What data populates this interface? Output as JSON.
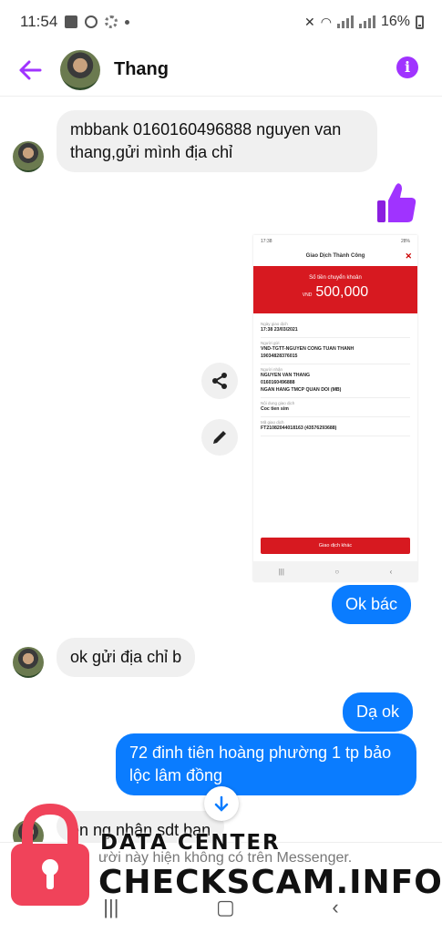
{
  "status_bar": {
    "time": "11:54",
    "battery": "16%"
  },
  "header": {
    "contact_name": "Thang"
  },
  "messages": {
    "m1": "mbbank 0160160496888 nguyen van thang,gửi mình địa chỉ",
    "m2": "Ok bác",
    "m3": "ok gửi địa chỉ b",
    "m4": "Dạ ok",
    "m5": "72 đinh tiên hoàng phường 1 tp bảo lộc lâm đồng",
    "m6": "ên ng nhận sdt bạn"
  },
  "receipt": {
    "status_time": "17:38",
    "status_right": "28%",
    "title": "Giao Dịch Thành Công",
    "amount_label": "Số tiền chuyển khoản",
    "currency": "VND",
    "amount": "500,000",
    "rows": [
      {
        "k": "Ngày giao dịch",
        "v": "17:38 23/03/2021"
      },
      {
        "k": "Người gửi",
        "v": "VND-TGTT-NGUYEN CONG TUAN THANH\n19034828376015"
      },
      {
        "k": "Người nhận",
        "v": "NGUYEN VAN THANG\n0160160496888\nNGAN HANG TMCP QUAN DOI (MB)"
      },
      {
        "k": "Nội dung giao dịch",
        "v": "Coc tien sim"
      },
      {
        "k": "Mã giao dịch",
        "v": "FT21082044018163 (43576293688)"
      }
    ],
    "button": "Giao dịch khác"
  },
  "footer": {
    "note": "ười này hiện không có trên Messenger."
  },
  "watermark": {
    "line1": "DATA CENTER",
    "line2": "CHECKSCAM.INFO"
  },
  "colors": {
    "accent": "#a033ff",
    "outgoing": "#0a7cff",
    "incoming": "#f0f0f0",
    "bank_red": "#d71920"
  }
}
